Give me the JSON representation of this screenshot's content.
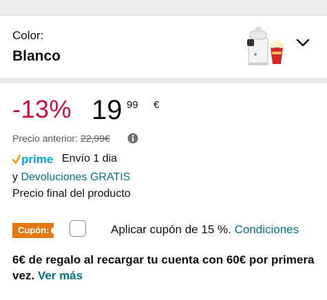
{
  "variant": {
    "label": "Color:",
    "value": "Blanco",
    "thumbnail_icon": "popcorn-maker-product-thumbnail",
    "dropdown_icon": "chevron-down-icon"
  },
  "price": {
    "discount": "-13%",
    "whole": "19",
    "fraction": "99",
    "currency": "€",
    "previous_label": "Precio anterior:",
    "previous_value": "22,99€",
    "info_icon": "info-icon"
  },
  "shipping": {
    "prime_logo": "prime",
    "delivery": "Envío 1 dia",
    "returns_prefix": "y",
    "returns_link": "Devoluciones GRATIS",
    "final_price_text": "Precio final del producto"
  },
  "coupon": {
    "badge": "Cupón:",
    "text": "Aplicar cupón de 15 %.",
    "link": "Condiciones",
    "checked": false
  },
  "promo": {
    "text": "6€ de regalo al recargar tu cuenta con 60€ por primera vez.",
    "link": "Ver más"
  },
  "colors": {
    "discount": "#cc0c39",
    "link": "#007185",
    "coupon_badge": "#e47911",
    "prime_blue": "#00a8e1",
    "prime_check": "#ff9900"
  }
}
